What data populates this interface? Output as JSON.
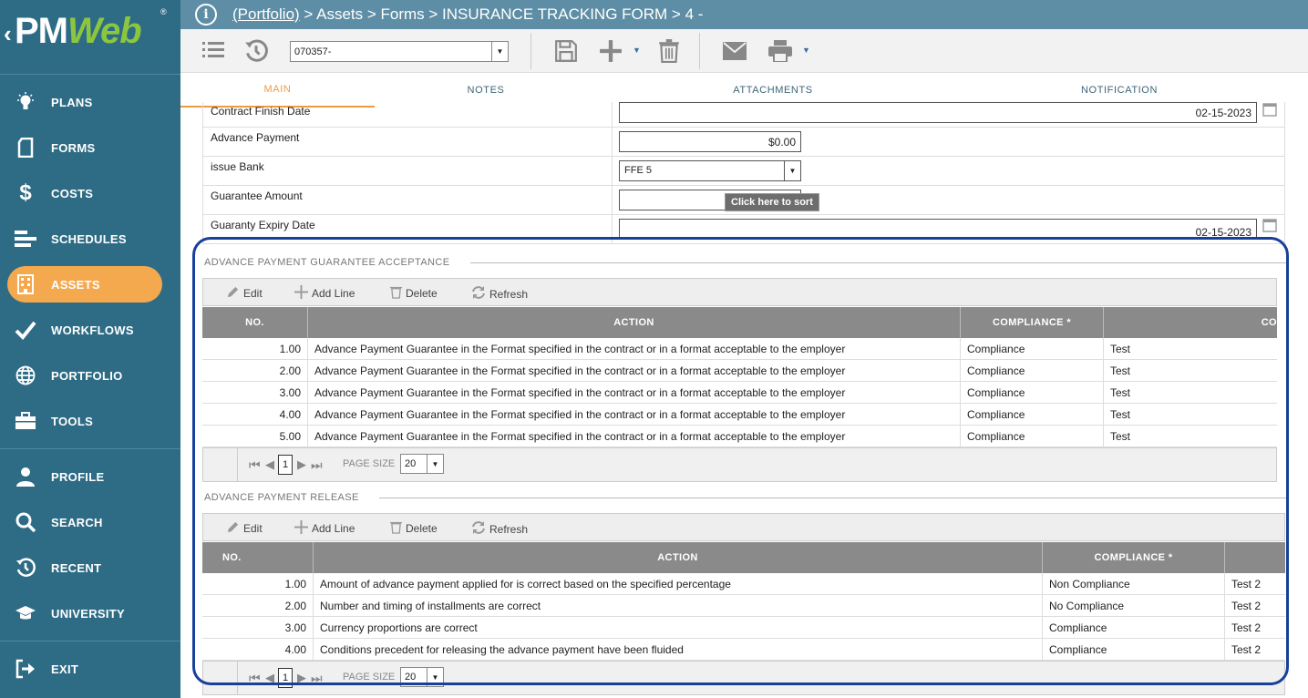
{
  "app": {
    "logo": "PMWeb",
    "logo_prefix": "PM",
    "logo_accent": "Web",
    "logo_reg": "®"
  },
  "sidebar": {
    "items": [
      {
        "label": "PLANS",
        "icon": "lightbulb-icon"
      },
      {
        "label": "FORMS",
        "icon": "document-icon"
      },
      {
        "label": "COSTS",
        "icon": "dollar-icon"
      },
      {
        "label": "SCHEDULES",
        "icon": "schedule-bars-icon"
      },
      {
        "label": "ASSETS",
        "icon": "building-icon",
        "active": true
      },
      {
        "label": "WORKFLOWS",
        "icon": "checkmark-icon"
      },
      {
        "label": "PORTFOLIO",
        "icon": "globe-icon"
      },
      {
        "label": "TOOLS",
        "icon": "toolbox-icon"
      },
      {
        "label": "PROFILE",
        "icon": "user-icon"
      },
      {
        "label": "SEARCH",
        "icon": "search-icon"
      },
      {
        "label": "RECENT",
        "icon": "history-icon"
      },
      {
        "label": "UNIVERSITY",
        "icon": "graduation-cap-icon"
      },
      {
        "label": "EXIT",
        "icon": "exit-icon"
      }
    ]
  },
  "header": {
    "portfolio_link": "(Portfolio)",
    "breadcrumb_rest": " > Assets > Forms > INSURANCE TRACKING FORM > 4 -"
  },
  "toolbar": {
    "record_value": "070357-"
  },
  "tabs": [
    "MAIN",
    "NOTES",
    "ATTACHMENTS",
    "NOTIFICATION"
  ],
  "form": {
    "contract_finish_label": "Contract Finish Date",
    "contract_finish_value": "02-15-2023",
    "advance_payment_label": "Advance Payment",
    "advance_payment_value": "$0.00",
    "issue_bank_label": "issue Bank",
    "issue_bank_value": "FFE 5",
    "guarantee_amount_label": "Guarantee Amount",
    "guaranty_expiry_label": "Guaranty Expiry Date",
    "guaranty_expiry_value": "02-15-2023"
  },
  "tooltip": "Click here to sort",
  "grid_tools": {
    "edit": "Edit",
    "add_line": "Add Line",
    "delete": "Delete",
    "refresh": "Refresh"
  },
  "pager": {
    "page": "1",
    "page_size_label": "PAGE SIZE",
    "page_size": "20"
  },
  "section1": {
    "title": "ADVANCE PAYMENT GUARANTEE ACCEPTANCE",
    "columns": [
      "NO.",
      "ACTION",
      "COMPLIANCE *",
      "CO"
    ],
    "rows": [
      [
        "1.00",
        "Advance Payment Guarantee in the Format specified in the contract or in a format acceptable to the employer",
        "Compliance",
        "Test"
      ],
      [
        "2.00",
        "Advance Payment Guarantee in the Format specified in the contract or in a format acceptable to the employer",
        "Compliance",
        "Test"
      ],
      [
        "3.00",
        "Advance Payment Guarantee in the Format specified in the contract or in a format acceptable to the employer",
        "Compliance",
        "Test"
      ],
      [
        "4.00",
        "Advance Payment Guarantee in the Format specified in the contract or in a format acceptable to the employer",
        "Compliance",
        "Test"
      ],
      [
        "5.00",
        "Advance Payment Guarantee in the Format specified in the contract or in a format acceptable to the employer",
        "Compliance",
        "Test"
      ]
    ]
  },
  "section2": {
    "title": "ADVANCE PAYMENT RELEASE",
    "columns": [
      "NO.",
      "ACTION",
      "COMPLIANCE *",
      ""
    ],
    "rows": [
      [
        "1.00",
        "Amount of advance payment applied for is correct based on the specified percentage",
        "Non Compliance",
        "Test 2"
      ],
      [
        "2.00",
        "Number and timing of installments are correct",
        "No Compliance",
        "Test 2"
      ],
      [
        "3.00",
        "Currency proportions are correct",
        "Compliance",
        "Test 2"
      ],
      [
        "4.00",
        "Conditions precedent for releasing the advance payment have been fluided",
        "Compliance",
        "Test 2"
      ]
    ]
  },
  "colors": {
    "sidebar": "#2e6c86",
    "active": "#f5a94e",
    "header": "#5e8ea5",
    "highlight": "#17409a",
    "grid_header": "#8a8a8a"
  }
}
